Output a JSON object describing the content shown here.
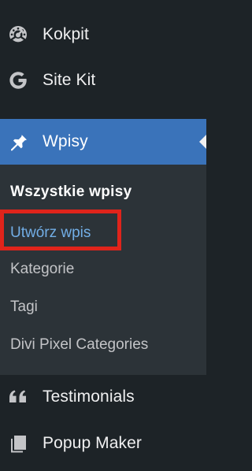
{
  "menu": {
    "items": [
      {
        "label": "Kokpit",
        "icon": "dashboard-gauge-icon"
      },
      {
        "label": "Site Kit",
        "icon": "google-g-icon"
      },
      {
        "label": "Wpisy",
        "icon": "pushpin-icon"
      },
      {
        "label": "Testimonials",
        "icon": "quote-icon"
      },
      {
        "label": "Popup Maker",
        "icon": "pages-icon"
      }
    ]
  },
  "submenu": {
    "items": [
      {
        "label": "Wszystkie wpisy"
      },
      {
        "label": "Utwórz wpis"
      },
      {
        "label": "Kategorie"
      },
      {
        "label": "Tagi"
      },
      {
        "label": "Divi Pixel Categories"
      }
    ]
  },
  "colors": {
    "sidebar_bg": "#1d2327",
    "submenu_bg": "#2c3338",
    "active_bg": "#3a73ba",
    "highlight_text": "#72aee6",
    "annotation_red": "#e0241b"
  }
}
